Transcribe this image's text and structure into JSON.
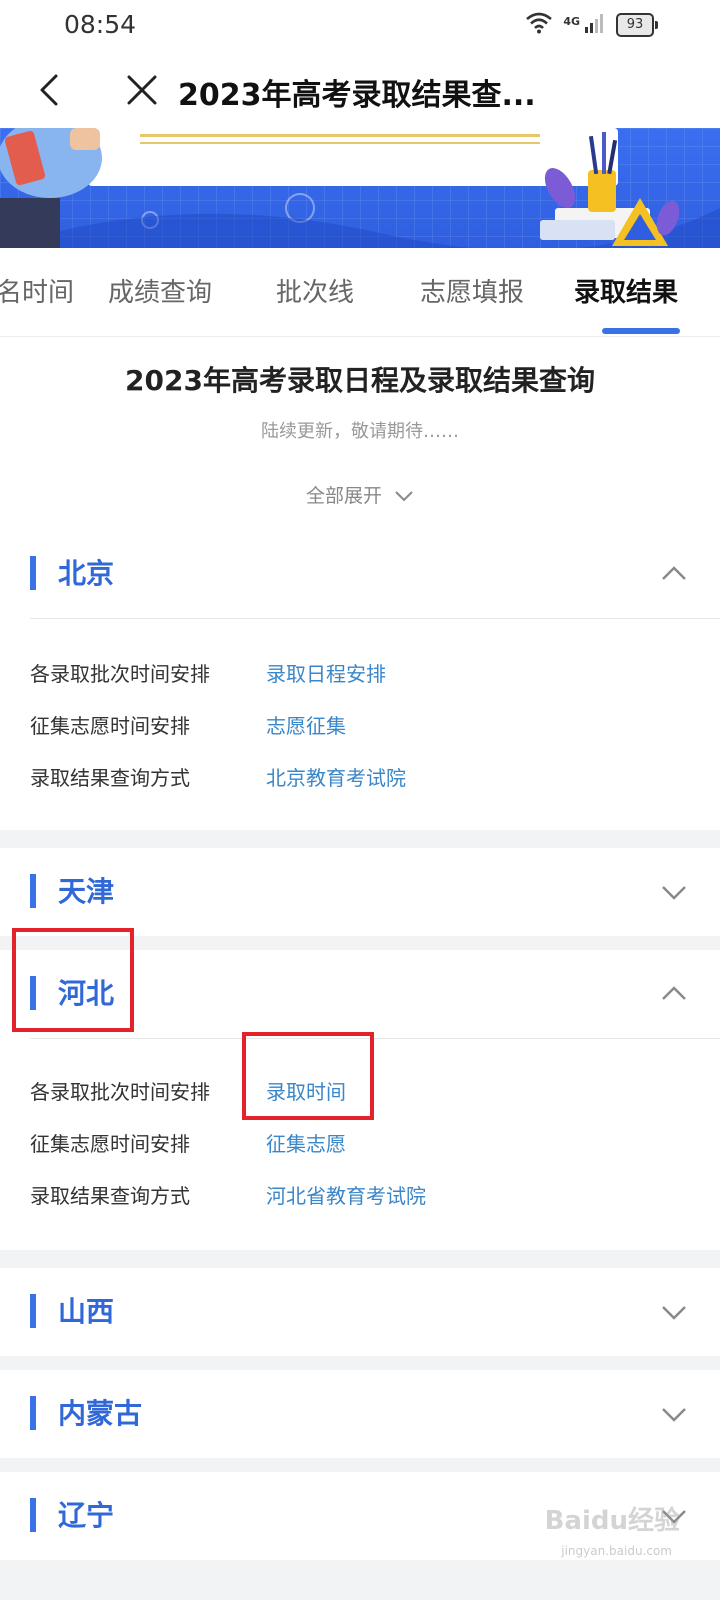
{
  "status_bar": {
    "time": "08:54",
    "network_label": "4G",
    "battery": "93"
  },
  "title_bar": {
    "title": "2023年高考录取结果查..."
  },
  "tabs": [
    {
      "label": "名时间"
    },
    {
      "label": "成绩查询"
    },
    {
      "label": "批次线"
    },
    {
      "label": "志愿填报"
    },
    {
      "label": "录取结果",
      "active": true
    }
  ],
  "intro": {
    "title": "2023年高考录取日程及录取结果查询",
    "subtitle": "陆续更新，敬请期待……",
    "expand_all": "全部展开"
  },
  "sections": [
    {
      "name": "北京",
      "expanded": true,
      "rows": [
        {
          "label": "各录取批次时间安排",
          "link": "录取日程安排"
        },
        {
          "label": "征集志愿时间安排",
          "link": "志愿征集"
        },
        {
          "label": "录取结果查询方式",
          "link": "北京教育考试院"
        }
      ]
    },
    {
      "name": "天津",
      "expanded": false
    },
    {
      "name": "河北",
      "expanded": true,
      "rows": [
        {
          "label": "各录取批次时间安排",
          "link": "录取时间"
        },
        {
          "label": "征集志愿时间安排",
          "link": "征集志愿"
        },
        {
          "label": "录取结果查询方式",
          "link": "河北省教育考试院"
        }
      ]
    },
    {
      "name": "山西",
      "expanded": false
    },
    {
      "name": "内蒙古",
      "expanded": false
    },
    {
      "name": "辽宁",
      "expanded": false
    }
  ],
  "colors": {
    "accent_blue": "#3872e6",
    "link_blue": "#3a86c8",
    "highlight_red": "#e3222a"
  },
  "watermark": {
    "text": "Baidu经验",
    "sub": "jingyan.baidu.com"
  }
}
